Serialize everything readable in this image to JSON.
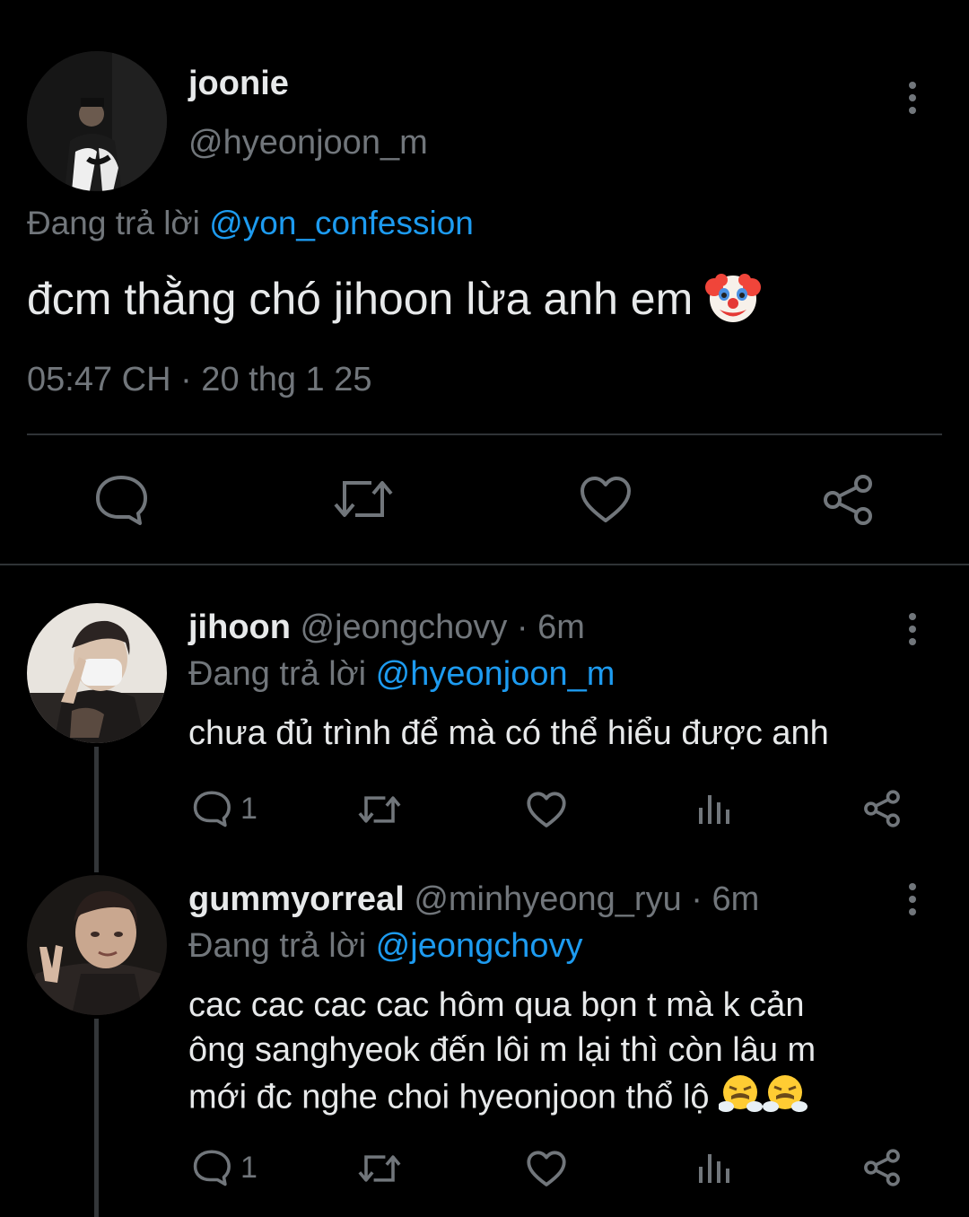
{
  "main_tweet": {
    "name": "joonie",
    "handle": "@hyeonjoon_m",
    "replying_prefix": "Đang trả lời",
    "replying_to": "@yon_confession",
    "text": "đcm thằng chó jihoon lừa anh em",
    "text_emoji": "clown-face-emoji",
    "timestamp": "05:47 CH · 20 thg 1 25",
    "actions": [
      "reply-icon",
      "retweet-icon",
      "like-icon",
      "share-icon"
    ]
  },
  "replies": [
    {
      "name": "jihoon",
      "handle": "@jeongchovy",
      "time": "· 6m",
      "replying_prefix": "Đang trả lời",
      "replying_to": "@hyeonjoon_m",
      "text": "chưa đủ trình để mà có thể hiểu được anh",
      "reply_count": "1"
    },
    {
      "name": "gummyorreal",
      "handle": "@minhyeong_ryu",
      "time": "· 6m",
      "replying_prefix": "Đang trả lời",
      "replying_to": "@jeongchovy",
      "text_lines": [
        "cac cac cac cac hôm qua bọn t mà k cản",
        "ông sanghyeok đến lôi m lại thì còn lâu m",
        "mới đc nghe choi hyeonjoon thổ lộ"
      ],
      "text_emoji": "face-with-steam-from-nose-emoji",
      "reply_count": "1"
    }
  ],
  "colors": {
    "background": "#000000",
    "text": "#e7e9ea",
    "muted": "#71767b",
    "link": "#1d9bf0",
    "divider": "#2f3336"
  }
}
